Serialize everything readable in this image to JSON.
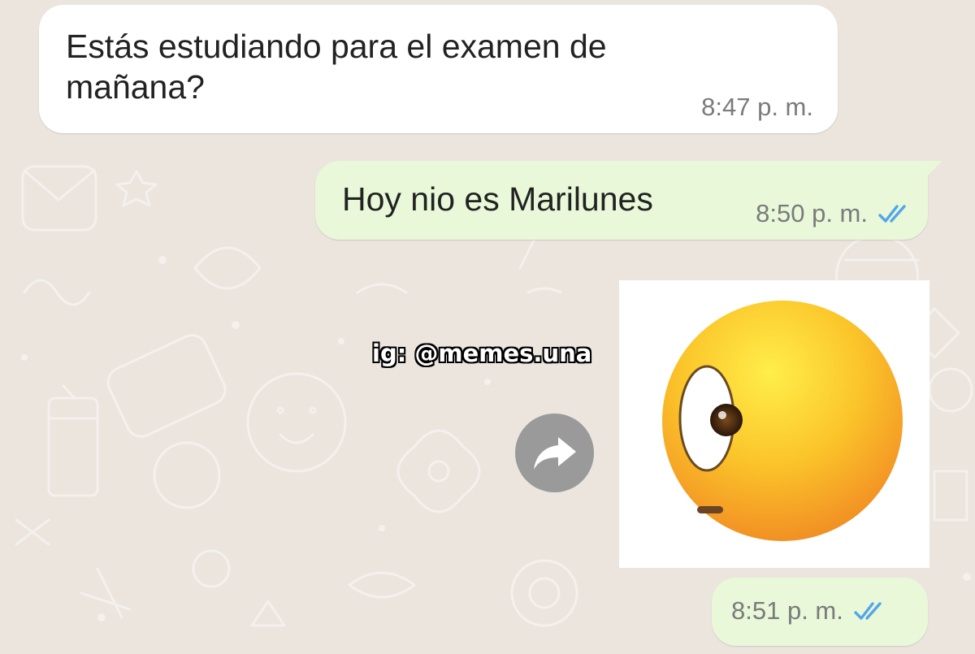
{
  "theme": {
    "wallpaper": "#ebe5de",
    "incoming_bubble": "#ffffff",
    "outgoing_bubble": "#e8f8d9",
    "read_tick_color": "#53a6e9",
    "forward_button_color": "#9a9a9a"
  },
  "messages": [
    {
      "direction": "incoming",
      "text": "Estás estudiando para el examen de mañana?",
      "time": "8:47 p. m."
    },
    {
      "direction": "outgoing",
      "text": "Hoy nio es Marilunes",
      "time": "8:50 p. m.",
      "status": "read",
      "status_icon": "double-check-icon"
    },
    {
      "direction": "outgoing",
      "type": "sticker",
      "sticker": "face-with-rolling-eye-emoji",
      "time": "8:51 p. m.",
      "status": "read",
      "status_icon": "double-check-icon"
    }
  ],
  "forward_icon": "forward-arrow-icon",
  "watermark": "ig: @memes.una"
}
